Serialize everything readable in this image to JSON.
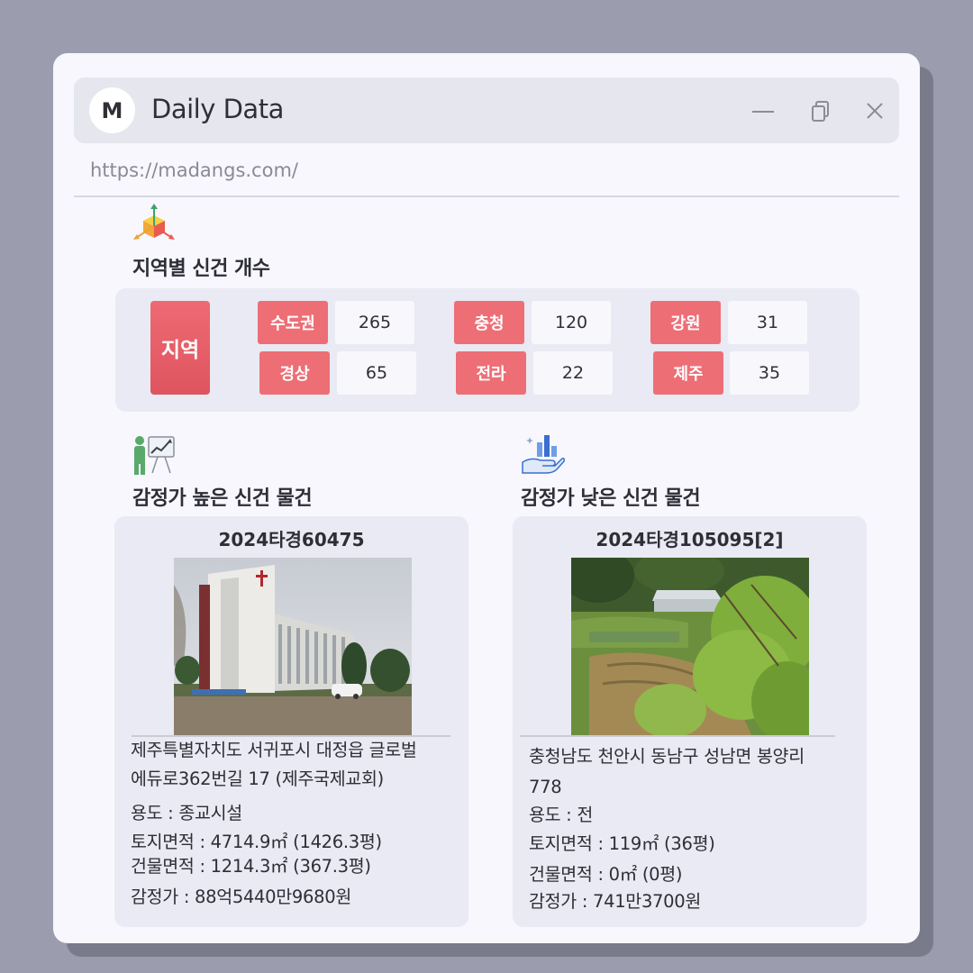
{
  "app": {
    "logo_letter": "M",
    "title": "Daily Data",
    "url": "https://madangs.com/"
  },
  "sections": {
    "region_title": "지역별 신건 개수",
    "high_title": "감정가 높은 신건 물건",
    "low_title": "감정가 낮은 신건 물건"
  },
  "regions": {
    "header": "지역",
    "items": [
      {
        "name": "수도권",
        "count": "265"
      },
      {
        "name": "충청",
        "count": "120"
      },
      {
        "name": "강원",
        "count": "31"
      },
      {
        "name": "경상",
        "count": "65"
      },
      {
        "name": "전라",
        "count": "22"
      },
      {
        "name": "제주",
        "count": "35"
      }
    ]
  },
  "high": {
    "case_no": "2024타경60475",
    "address_line1": "제주특별자치도 서귀포시 대정읍 글로벌",
    "address_line2": "에듀로362번길 17 (제주국제교회)",
    "usage": "용도 : 종교시설",
    "land_area": "토지면적 : 4714.9㎡ (1426.3평)",
    "building_area": "건물면적 : 1214.3㎡ (367.3평)",
    "appraisal": "감정가 : 88억5440만9680원"
  },
  "low": {
    "case_no": "2024타경105095[2]",
    "address_line1": "충청남도 천안시 동남구 성남면 봉양리",
    "address_line2": "778",
    "usage": "용도 : 전",
    "land_area": "토지면적 : 119㎡ (36평)",
    "building_area": "건물면적 : 0㎡ (0평)",
    "appraisal": "감정가 : 741만3700원"
  },
  "colors": {
    "accent": "#ee6e76",
    "panel": "#e9eaf3",
    "background": "#9b9cad"
  },
  "icons": {
    "region": "cube-axes-icon",
    "high": "presentation-chart-icon",
    "low": "hand-bar-chart-icon"
  }
}
